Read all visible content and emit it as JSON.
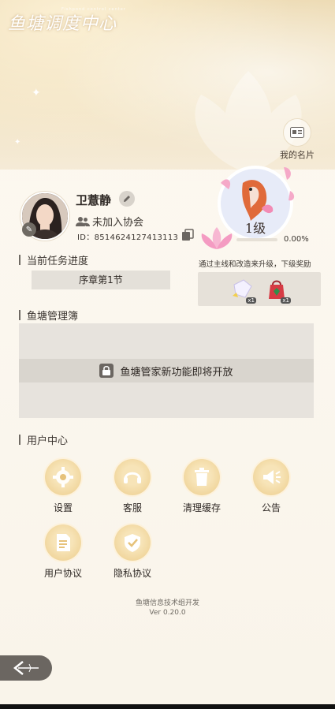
{
  "app": {
    "title": "鱼塘调度中心",
    "subtitle": "Fishpond control center"
  },
  "namecard": {
    "label": "我的名片",
    "icon": "id-card-icon"
  },
  "profile": {
    "username": "卫薏静",
    "association": "未加入协会",
    "id_label": "ID：",
    "id_value": "8514624127413113"
  },
  "level": {
    "label": "1级",
    "progress_text": "0.00%",
    "progress_fraction": 0.0,
    "upgrade_tip": "通过主线和改造来升级，下级奖励",
    "rewards": [
      {
        "icon": "crystal-gift-icon",
        "count": "x1"
      },
      {
        "icon": "red-bag-icon",
        "count": "x1"
      }
    ]
  },
  "task": {
    "section_title": "当前任务进度",
    "value": "序章第1节"
  },
  "manage": {
    "section_title": "鱼塘管理簿",
    "locked_text": "鱼塘管家新功能即将开放"
  },
  "user_center": {
    "section_title": "用户中心",
    "buttons": [
      {
        "label": "设置",
        "icon": "gear-icon"
      },
      {
        "label": "客服",
        "icon": "headset-icon"
      },
      {
        "label": "清理缓存",
        "icon": "trash-icon"
      },
      {
        "label": "公告",
        "icon": "megaphone-icon"
      },
      {
        "label": "用户协议",
        "icon": "document-icon"
      },
      {
        "label": "隐私协议",
        "icon": "shield-check-icon"
      }
    ]
  },
  "footer": {
    "dev": "鱼塘信息技术组开发",
    "version": "Ver 0.20.0"
  },
  "colors": {
    "accent": "#d4a65c",
    "panel": "#e7e3dd",
    "icon_bg": "#f1d79f"
  }
}
